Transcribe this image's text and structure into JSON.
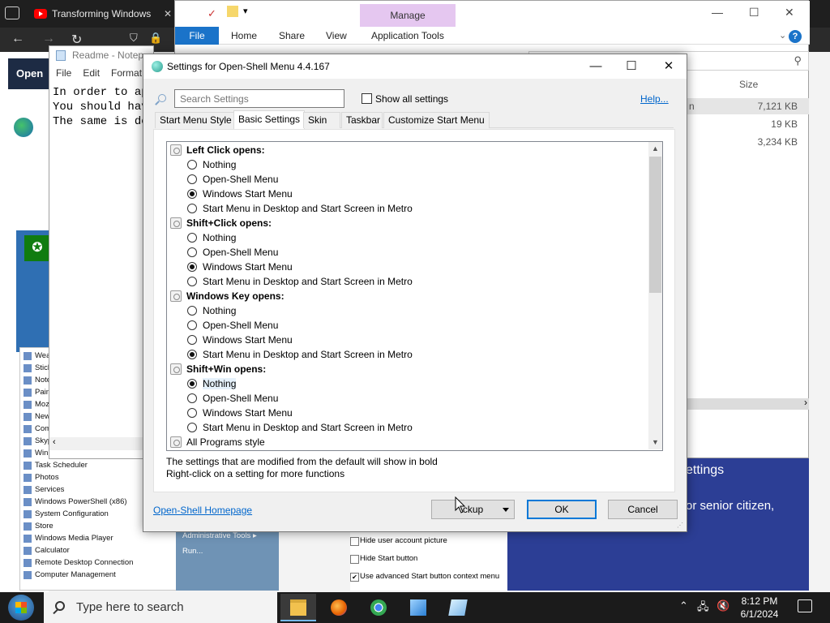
{
  "browser": {
    "tab_title": "Transforming Windows",
    "open_button": "Open F"
  },
  "notepad": {
    "title": "Readme - Notep",
    "menu": [
      "File",
      "Edit",
      "Format"
    ],
    "lines": [
      "In order to ap",
      "You should hav",
      "The same is do"
    ]
  },
  "explorer": {
    "manage_tab": "Manage",
    "ribbon": [
      "File",
      "Home",
      "Share",
      "View",
      "Application Tools"
    ],
    "size_header": "Size",
    "rows": [
      {
        "name": "n",
        "size": "7,121 KB"
      },
      {
        "name": "",
        "size": "19 KB"
      },
      {
        "name": "",
        "size": "3,234 KB"
      }
    ]
  },
  "start_menu": {
    "items": [
      "Wea",
      "Stick",
      "Note",
      "Pain",
      "Moz",
      "New",
      "Com",
      "Skyp",
      "Win",
      "Task Scheduler",
      "Photos",
      "Services",
      "Windows PowerShell (x86)",
      "System Configuration",
      "Store",
      "Windows Media Player",
      "Calculator",
      "Remote Desktop Connection",
      "Computer Management"
    ],
    "right_items": [
      "Administrative Tools",
      "Run..."
    ],
    "checkboxes": [
      {
        "label": "Hide user account picture",
        "checked": false
      },
      {
        "label": "Hide Start button",
        "checked": false
      },
      {
        "label": "Use advanced Start button context menu",
        "checked": true
      }
    ]
  },
  "article": {
    "heading": "ettings",
    "line": "or senior citizen,"
  },
  "dialog": {
    "title": "Settings for Open-Shell Menu 4.4.167",
    "search_placeholder": "Search Settings",
    "show_all_label": "Show all settings",
    "help_link": "Help...",
    "tabs": [
      "Start Menu Style",
      "Basic Settings",
      "Skin",
      "Taskbar",
      "Customize Start Menu"
    ],
    "active_tab": "Basic Settings",
    "groups": [
      {
        "label": "Left Click opens:",
        "options": [
          {
            "label": "Nothing",
            "selected": false
          },
          {
            "label": "Open-Shell Menu",
            "selected": false
          },
          {
            "label": "Windows Start Menu",
            "selected": true
          },
          {
            "label": "Start Menu in Desktop and Start Screen in Metro",
            "selected": false
          }
        ]
      },
      {
        "label": "Shift+Click opens:",
        "options": [
          {
            "label": "Nothing",
            "selected": false
          },
          {
            "label": "Open-Shell Menu",
            "selected": false
          },
          {
            "label": "Windows Start Menu",
            "selected": true
          },
          {
            "label": "Start Menu in Desktop and Start Screen in Metro",
            "selected": false
          }
        ]
      },
      {
        "label": "Windows Key opens:",
        "options": [
          {
            "label": "Nothing",
            "selected": false
          },
          {
            "label": "Open-Shell Menu",
            "selected": false
          },
          {
            "label": "Windows Start Menu",
            "selected": false
          },
          {
            "label": "Start Menu in Desktop and Start Screen in Metro",
            "selected": true
          }
        ]
      },
      {
        "label": "Shift+Win opens:",
        "options": [
          {
            "label": "Nothing",
            "selected": true
          },
          {
            "label": "Open-Shell Menu",
            "selected": false
          },
          {
            "label": "Windows Start Menu",
            "selected": false
          },
          {
            "label": "Start Menu in Desktop and Start Screen in Metro",
            "selected": false
          }
        ]
      }
    ],
    "last_item": "All Programs style",
    "note_line1": "The settings that are modified from the default will show in bold",
    "note_line2": "Right-click on a setting for more functions",
    "homepage_link": "Open-Shell Homepage",
    "backup_button": "ckup",
    "ok_button": "OK",
    "cancel_button": "Cancel"
  },
  "taskbar": {
    "search_placeholder": "Type here to search",
    "time": "8:12 PM",
    "date": "6/1/2024"
  }
}
